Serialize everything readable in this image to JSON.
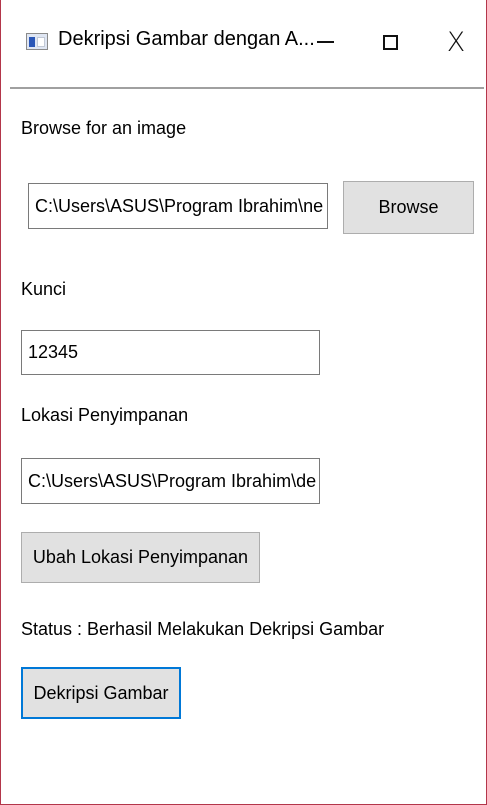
{
  "window": {
    "title": "Dekripsi Gambar dengan A...",
    "controls": {
      "minimize": "—",
      "maximize": "☐",
      "close": "X"
    }
  },
  "browse": {
    "label": "Browse for an image",
    "path_value": "C:\\Users\\ASUS\\Program Ibrahim\\ne",
    "button_label": "Browse"
  },
  "key": {
    "label": "Kunci",
    "value": "12345"
  },
  "save_location": {
    "label": "Lokasi Penyimpanan",
    "value": "C:\\Users\\ASUS\\Program Ibrahim\\de",
    "change_button_label": "Ubah Lokasi Penyimpanan"
  },
  "status": {
    "text": "Status : Berhasil Melakukan Dekripsi Gambar"
  },
  "actions": {
    "decrypt_button_label": "Dekripsi Gambar"
  }
}
